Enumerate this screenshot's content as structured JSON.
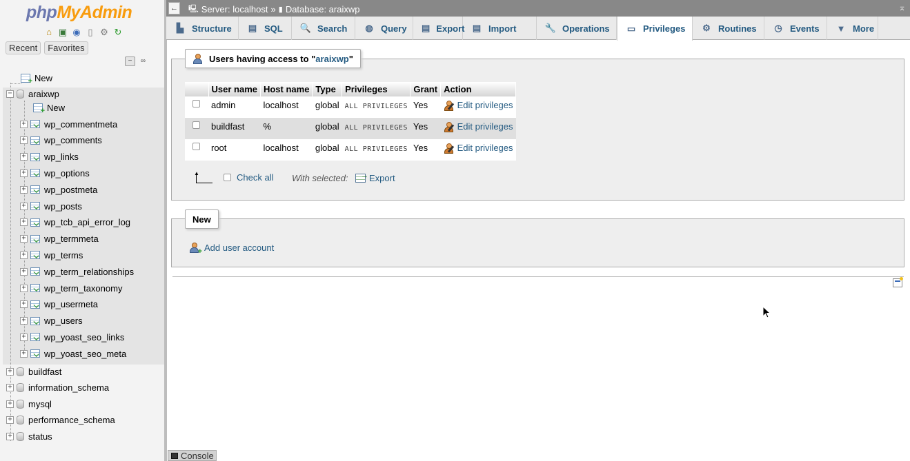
{
  "nav": {
    "logo_php": "php",
    "logo_myadmin": "MyAdmin",
    "recent_label": "Recent",
    "favorites_label": "Favorites",
    "tree": {
      "new_label": "New",
      "current_db": "araixwp",
      "db_new_label": "New",
      "tables": [
        "wp_commentmeta",
        "wp_comments",
        "wp_links",
        "wp_options",
        "wp_postmeta",
        "wp_posts",
        "wp_tcb_api_error_log",
        "wp_termmeta",
        "wp_terms",
        "wp_term_relationships",
        "wp_term_taxonomy",
        "wp_usermeta",
        "wp_users",
        "wp_yoast_seo_links",
        "wp_yoast_seo_meta"
      ],
      "other_dbs": [
        "buildfast",
        "information_schema",
        "mysql",
        "performance_schema",
        "status"
      ]
    }
  },
  "topbar": {
    "back_label": "←",
    "server_label": "Server: localhost",
    "separator": "»",
    "database_label": "Database: araixwp",
    "collapse_label": "⌅"
  },
  "tabs": [
    {
      "label": "Structure",
      "icon": "structure-icon",
      "glyph": "▙"
    },
    {
      "label": "SQL",
      "icon": "sql-icon",
      "glyph": "▤"
    },
    {
      "label": "Search",
      "icon": "search-icon",
      "glyph": "🔍"
    },
    {
      "label": "Query",
      "icon": "query-icon",
      "glyph": "◍"
    },
    {
      "label": "Export",
      "icon": "export-icon",
      "glyph": "▤"
    },
    {
      "label": "Import",
      "icon": "import-icon",
      "glyph": "▤"
    },
    {
      "label": "Operations",
      "icon": "wrench-icon",
      "glyph": "🔧"
    },
    {
      "label": "Privileges",
      "icon": "privileges-icon",
      "glyph": "▭"
    },
    {
      "label": "Routines",
      "icon": "routines-icon",
      "glyph": "⚙"
    },
    {
      "label": "Events",
      "icon": "clock-icon",
      "glyph": "◷"
    },
    {
      "label": "More",
      "icon": "chevron-down-icon",
      "glyph": "▼"
    }
  ],
  "users_box": {
    "legend_prefix": "Users having access to \"",
    "legend_db": "araixwp",
    "legend_suffix": "\"",
    "columns": [
      "",
      "User name",
      "Host name",
      "Type",
      "Privileges",
      "Grant",
      "Action"
    ],
    "rows": [
      {
        "user": "admin",
        "host": "localhost",
        "type": "global",
        "privileges": "ALL PRIVILEGES",
        "grant": "Yes",
        "action": "Edit privileges"
      },
      {
        "user": "buildfast",
        "host": "%",
        "type": "global",
        "privileges": "ALL PRIVILEGES",
        "grant": "Yes",
        "action": "Edit privileges"
      },
      {
        "user": "root",
        "host": "localhost",
        "type": "global",
        "privileges": "ALL PRIVILEGES",
        "grant": "Yes",
        "action": "Edit privileges"
      }
    ],
    "check_all_label": "Check all",
    "with_selected_label": "With selected:",
    "export_label": "Export"
  },
  "new_box": {
    "legend": "New",
    "add_user_label": "Add user account"
  },
  "console_label": "Console"
}
